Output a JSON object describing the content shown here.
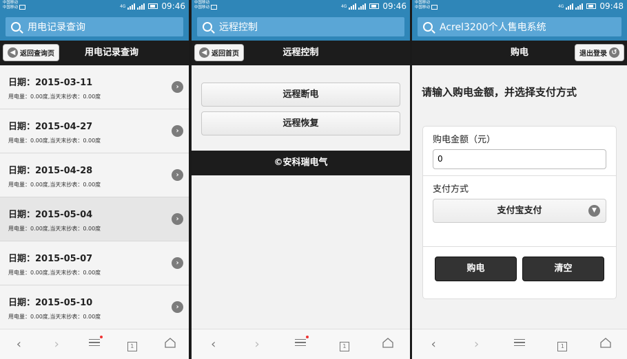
{
  "status_bars": [
    {
      "carrier1": "中国移动",
      "carrier2": "中国移动",
      "net": "4G",
      "time": "09:46"
    },
    {
      "carrier1": "中国移动",
      "carrier2": "中国移动",
      "net": "4G",
      "time": "09:46"
    },
    {
      "carrier1": "中国移动",
      "carrier2": "中国移动",
      "net": "4G",
      "time": "09:48"
    }
  ],
  "screen1": {
    "url_title": "用电记录查询",
    "back_label": "返回查询页",
    "header_title": "用电记录查询",
    "records": [
      {
        "date": "日期：2015-03-11",
        "usage": "用电量：0.00度,当天末抄表：0.00度"
      },
      {
        "date": "日期：2015-04-27",
        "usage": "用电量：0.00度,当天末抄表：0.00度"
      },
      {
        "date": "日期：2015-04-28",
        "usage": "用电量：0.00度,当天末抄表：0.00度"
      },
      {
        "date": "日期：2015-05-04",
        "usage": "用电量：0.00度,当天末抄表：0.00度"
      },
      {
        "date": "日期：2015-05-07",
        "usage": "用电量：0.00度,当天末抄表：0.00度"
      },
      {
        "date": "日期：2015-05-10",
        "usage": "用电量：0.00度,当天末抄表：0.00度"
      }
    ]
  },
  "screen2": {
    "url_title": "远程控制",
    "back_label": "返回首页",
    "header_title": "远程控制",
    "button_disconnect": "远程断电",
    "button_restore": "远程恢复",
    "footer": "©安科瑞电气"
  },
  "screen3": {
    "url_title": "Acrel3200个人售电系统",
    "header_title": "购电",
    "logout_label": "退出登录",
    "prompt": "请输入购电金额，并选择支付方式",
    "amount_label": "购电金额（元）",
    "amount_value": "0",
    "pay_label": "支付方式",
    "pay_selected": "支付宝支付",
    "buy_button": "购电",
    "clear_button": "清空"
  },
  "nav": {
    "tab_count": "1"
  }
}
